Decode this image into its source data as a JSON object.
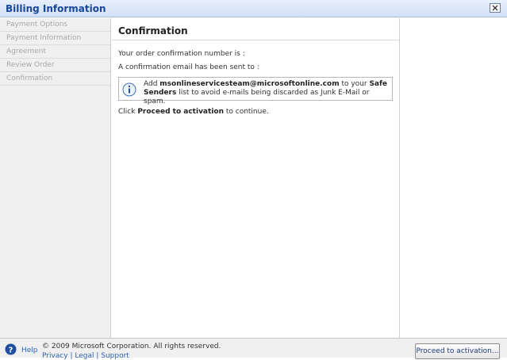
{
  "window": {
    "title": "Billing Information"
  },
  "sidebar": {
    "steps": [
      {
        "label": "Payment Options"
      },
      {
        "label": "Payment Information"
      },
      {
        "label": "Agreement"
      },
      {
        "label": "Review Order"
      },
      {
        "label": "Confirmation"
      }
    ]
  },
  "main": {
    "heading": "Confirmation",
    "order_number_text": "Your order confirmation number is :",
    "email_sent_text": "A confirmation email has been sent to :",
    "info": {
      "prefix": "Add ",
      "email": "msonlineservicesteam@microsoftonline.com",
      "middle": " to your ",
      "safe_senders": "Safe Senders",
      "suffix": " list to avoid e-mails being discarded as Junk E-Mail or spam."
    },
    "proceed_text": {
      "prefix": "Click ",
      "action": "Proceed to activation",
      "suffix": " to continue."
    }
  },
  "footer": {
    "help_label": "Help",
    "copyright": "© 2009 Microsoft Corporation. All rights reserved.",
    "links": [
      "Privacy",
      "Legal",
      "Support"
    ],
    "separator": " | ",
    "proceed_button": "Proceed to activation..."
  }
}
